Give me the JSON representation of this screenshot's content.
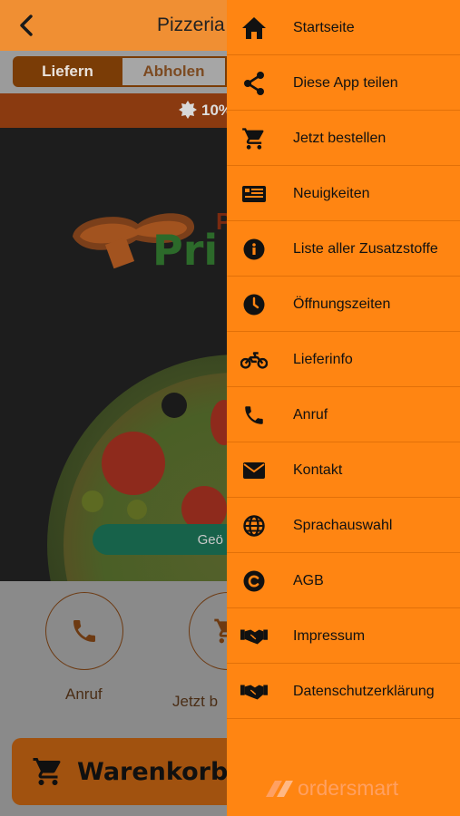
{
  "header": {
    "title": "Pizzeria P"
  },
  "order_mode": {
    "deliver_label": "Liefern",
    "pickup_label": "Abholen"
  },
  "promo": {
    "text": "10%"
  },
  "hero": {
    "logo_text": "Pri",
    "logo_text_top": "P",
    "button_label": "Geö"
  },
  "actions": [
    {
      "label": "Anruf",
      "icon": "phone-icon"
    },
    {
      "label": "Jetzt b",
      "icon": "cart-icon"
    }
  ],
  "cart": {
    "label": "Warenkorb"
  },
  "drawer": {
    "items": [
      {
        "label": "Startseite",
        "icon": "home-icon"
      },
      {
        "label": "Diese App teilen",
        "icon": "share-icon"
      },
      {
        "label": "Jetzt bestellen",
        "icon": "cart-icon"
      },
      {
        "label": "Neuigkeiten",
        "icon": "news-icon"
      },
      {
        "label": "Liste aller Zusatzstoffe",
        "icon": "info-icon"
      },
      {
        "label": "Öffnungszeiten",
        "icon": "clock-icon"
      },
      {
        "label": "Lieferinfo",
        "icon": "motorcycle-icon"
      },
      {
        "label": "Anruf",
        "icon": "phone-icon"
      },
      {
        "label": "Kontakt",
        "icon": "envelope-icon"
      },
      {
        "label": "Sprachauswahl",
        "icon": "globe-icon"
      },
      {
        "label": "AGB",
        "icon": "copyright-icon"
      },
      {
        "label": "Impressum",
        "icon": "handshake-icon"
      },
      {
        "label": "Datenschutzerklärung",
        "icon": "handshake-icon"
      }
    ],
    "brand": "ordersmart"
  },
  "colors": {
    "drawer_bg": "#ff8512",
    "topbar_bg": "#f08f33",
    "accent_brown": "#7a3c06",
    "geo_button": "#17624a"
  }
}
